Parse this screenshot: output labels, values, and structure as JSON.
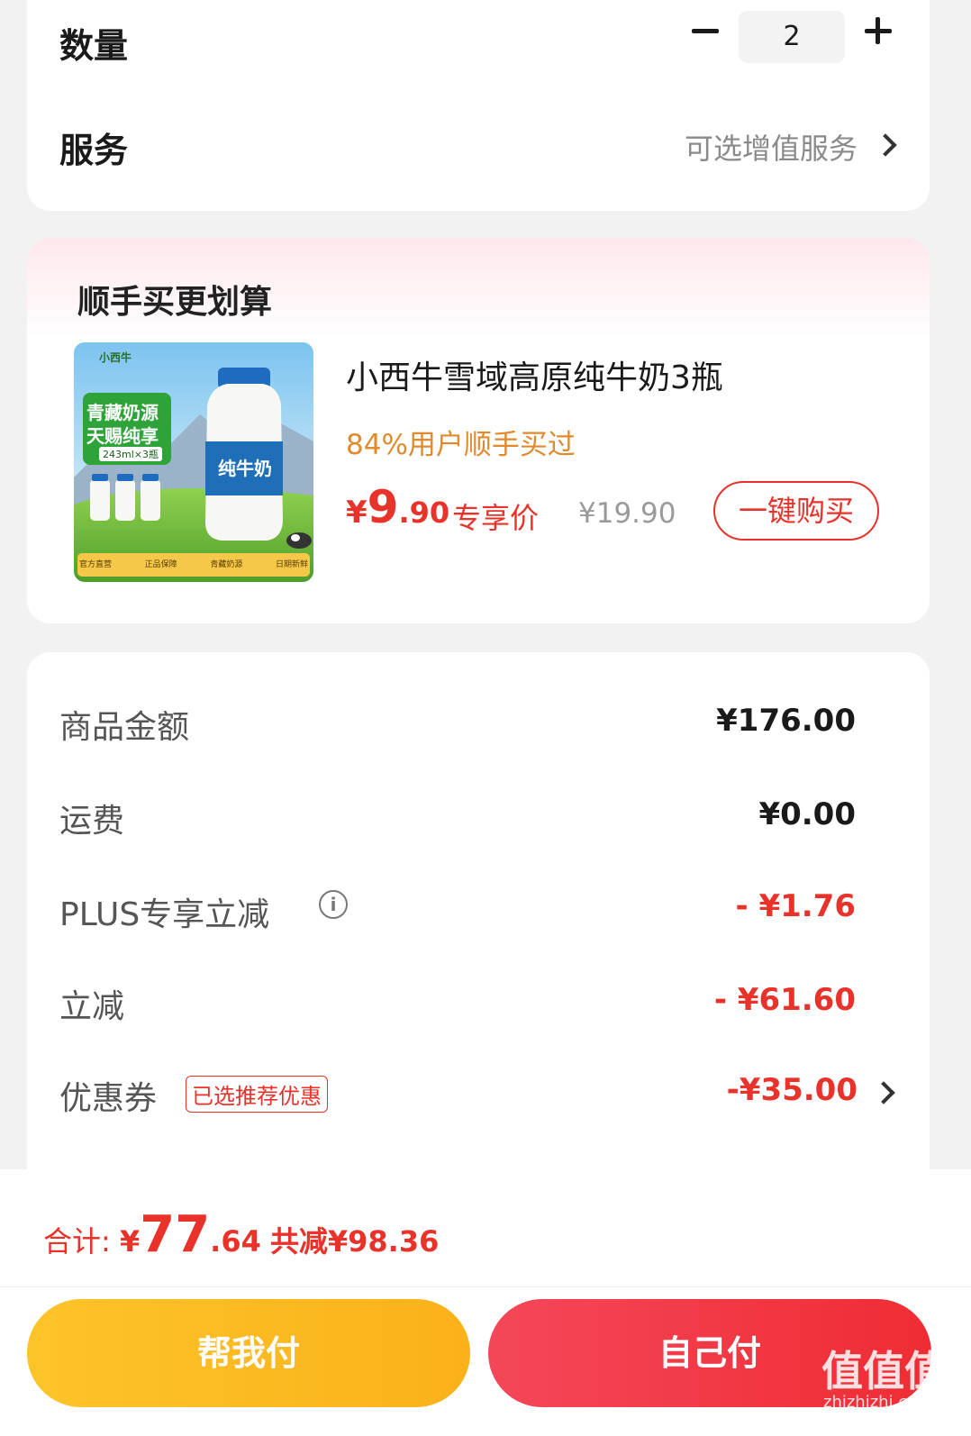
{
  "quantity": {
    "label": "数量",
    "value": "2"
  },
  "service": {
    "label": "服务",
    "hint": "可选增值服务"
  },
  "upsell": {
    "title": "顺手买更划算",
    "product": {
      "name": "小西牛雪域高原纯牛奶3瓶",
      "stat": "84%用户顺手买过",
      "price_symbol": "¥",
      "price_int": "9",
      "price_dec": ".90",
      "price_tag": "专享价",
      "price_old": "¥19.90",
      "buy_label": "一键购买",
      "image_text": {
        "brand": "小西牛",
        "badge_line1": "青藏奶源",
        "badge_line2": "天赐纯享",
        "spec": "243ml×3瓶",
        "bottle_label": "纯牛奶",
        "features": [
          "官方直营",
          "正品保障",
          "青藏奶源",
          "日期新鲜"
        ]
      }
    }
  },
  "summary": {
    "goods_label": "商品金额",
    "goods_value": "¥176.00",
    "shipping_label": "运费",
    "shipping_value": "¥0.00",
    "plus_label": "PLUS专享立减",
    "plus_value": "- ¥1.76",
    "discount_label": "立减",
    "discount_value": "- ¥61.60",
    "coupon_label": "优惠券",
    "coupon_tag": "已选推荐优惠",
    "coupon_value": "-¥35.00"
  },
  "footer": {
    "total_label": "合计: ",
    "total_symbol": "¥",
    "total_int": "77",
    "total_dec": ".64",
    "saved": "共减¥98.36",
    "help_pay": "帮我付",
    "self_pay": "自己付"
  },
  "watermark": {
    "text": "值值值",
    "url": "zhizhizhi.com"
  },
  "colors": {
    "accent_red": "#e8322a",
    "stat_orange": "#e08a2c",
    "help_btn": "#fbb11a",
    "self_btn": "#ef2c33"
  }
}
